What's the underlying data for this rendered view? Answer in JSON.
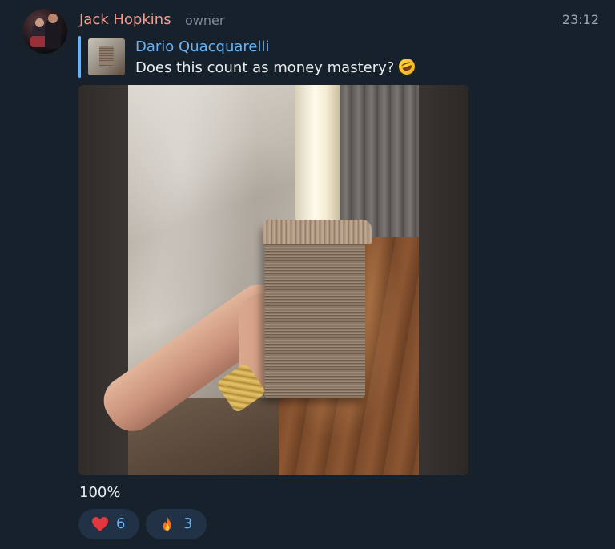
{
  "sender": {
    "name": "Jack Hopkins",
    "role": "owner"
  },
  "timestamp": "23:12",
  "reply": {
    "name": "Dario Quacquarelli",
    "text": "Does this count as money mastery?",
    "emoji": "rolling-on-floor-laughing"
  },
  "photo": {
    "description_icon": "photo"
  },
  "caption": "100%",
  "reactions": [
    {
      "emoji": "red-heart",
      "count": "6"
    },
    {
      "emoji": "fire",
      "count": "3"
    }
  ],
  "colors": {
    "background": "#17212b",
    "sender_name": "#f39a8e",
    "accent": "#6bb2f2",
    "reaction_bg": "#213246"
  }
}
